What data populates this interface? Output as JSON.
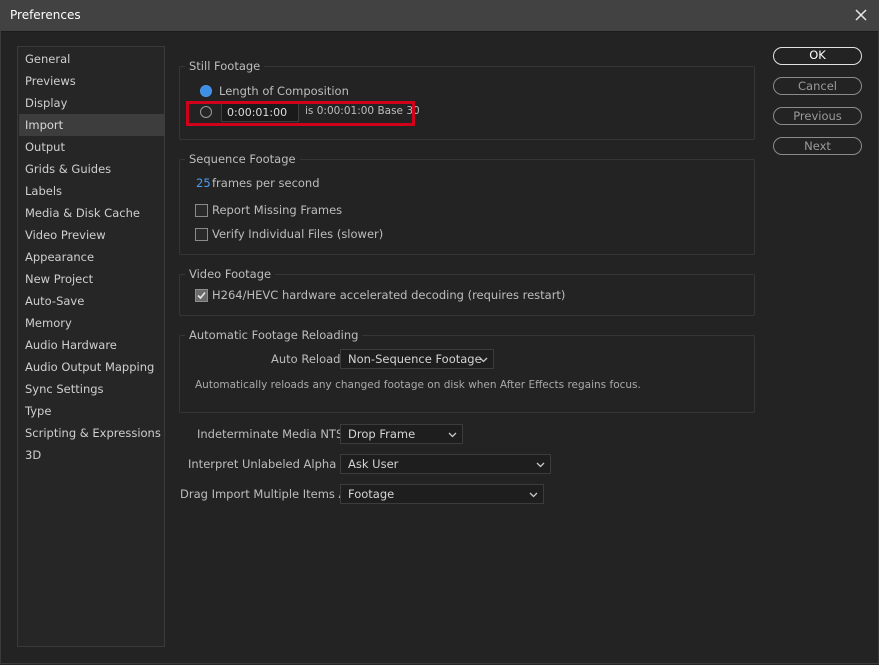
{
  "window": {
    "title": "Preferences"
  },
  "sidebar": {
    "items": [
      {
        "label": "General"
      },
      {
        "label": "Previews"
      },
      {
        "label": "Display"
      },
      {
        "label": "Import"
      },
      {
        "label": "Output"
      },
      {
        "label": "Grids & Guides"
      },
      {
        "label": "Labels"
      },
      {
        "label": "Media & Disk Cache"
      },
      {
        "label": "Video Preview"
      },
      {
        "label": "Appearance"
      },
      {
        "label": "New Project"
      },
      {
        "label": "Auto-Save"
      },
      {
        "label": "Memory"
      },
      {
        "label": "Audio Hardware"
      },
      {
        "label": "Audio Output Mapping"
      },
      {
        "label": "Sync Settings"
      },
      {
        "label": "Type"
      },
      {
        "label": "Scripting & Expressions"
      },
      {
        "label": "3D"
      }
    ],
    "selected": "Import"
  },
  "still_footage": {
    "title": "Still Footage",
    "length_option": "Length of Composition",
    "length_selected": true,
    "duration_value": "0:00:01:00",
    "duration_info": "is 0:00:01:00  Base 30"
  },
  "sequence_footage": {
    "title": "Sequence Footage",
    "fps_value": "25",
    "fps_label": "frames per second",
    "report_missing": {
      "label": "Report Missing Frames",
      "checked": false
    },
    "verify_files": {
      "label": "Verify Individual Files (slower)",
      "checked": false
    }
  },
  "video_footage": {
    "title": "Video Footage",
    "hw_decoding": {
      "label": "H264/HEVC hardware accelerated decoding (requires restart)",
      "checked": true
    }
  },
  "auto_reload": {
    "title": "Automatic Footage Reloading",
    "label": "Auto Reload:",
    "value": "Non-Sequence Footage",
    "description": "Automatically reloads any changed footage on disk when After Effects regains focus."
  },
  "misc": {
    "ntsc_label": "Indeterminate Media NTSC:",
    "ntsc_value": "Drop Frame",
    "alpha_label": "Interpret Unlabeled Alpha As:",
    "alpha_value": "Ask User",
    "drag_label": "Drag Import Multiple Items As:",
    "drag_value": "Footage"
  },
  "buttons": {
    "ok": "OK",
    "cancel": "Cancel",
    "previous": "Previous",
    "next": "Next"
  },
  "colors": {
    "accent": "#3d8ee5",
    "highlight_box": "#d0021b",
    "background": "#232323"
  }
}
